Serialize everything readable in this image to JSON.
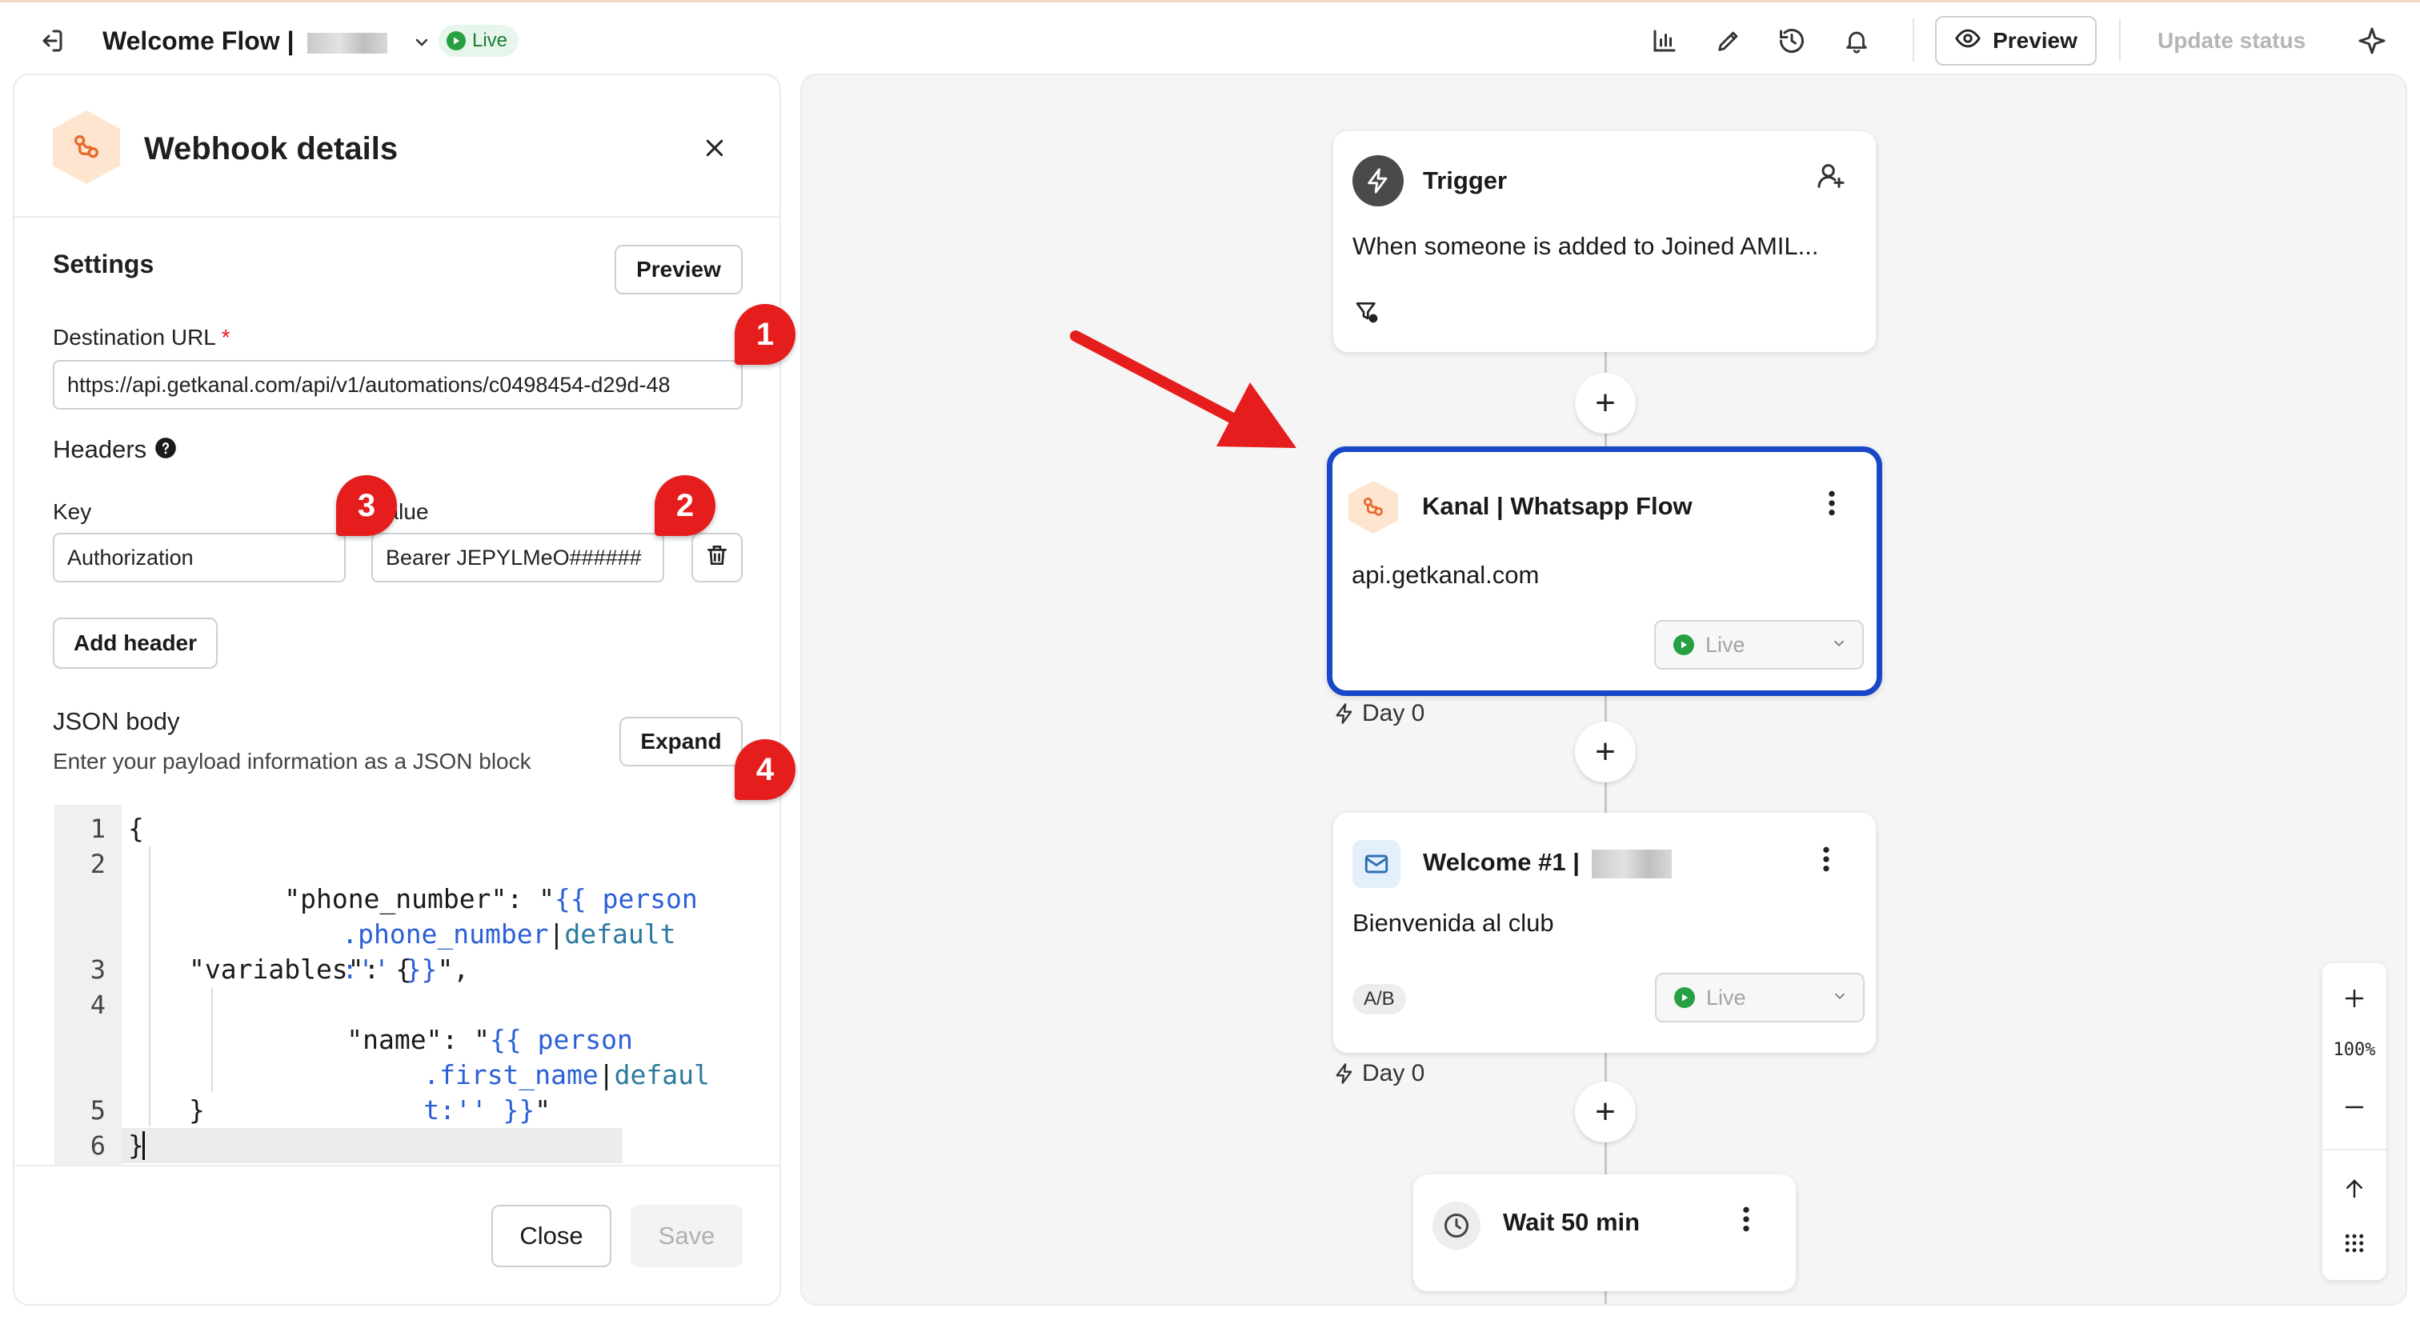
{
  "header": {
    "flow_title": "Welcome Flow |",
    "status": "Live",
    "preview_label": "Preview",
    "update_status_label": "Update status"
  },
  "panel": {
    "title": "Webhook details",
    "settings_title": "Settings",
    "preview_label": "Preview",
    "destination_url_label": "Destination URL",
    "required_mark": "*",
    "destination_url_value": "https://api.getkanal.com/api/v1/automations/c0498454-d29d-48",
    "headers_label": "Headers",
    "key_label": "Key",
    "value_label": "Value",
    "key_value": "Authorization",
    "value_value": "Bearer JEPYLMeO######",
    "add_header_label": "Add header",
    "json_body_label": "JSON body",
    "json_body_hint": "Enter your payload information as a JSON block",
    "expand_label": "Expand",
    "close_label": "Close",
    "save_label": "Save"
  },
  "code": {
    "line_numbers": [
      "1",
      "2",
      "3",
      "4",
      "5",
      "6"
    ],
    "l1": "{",
    "l2a": "\"phone_number\": \"",
    "l2b": "{{ person",
    "l2c": ".phone_number",
    "l2d": "|",
    "l2e": "default",
    "l2f": ":'' }}",
    "l2g": "\",",
    "l3": "\"variables\": {",
    "l4a": "\"name\": \"",
    "l4b": "{{ person",
    "l4c": ".first_name",
    "l4d": "|",
    "l4e": "defaul",
    "l4f": "t:'' }}",
    "l4g": "\"",
    "l5": "}",
    "l6": "}"
  },
  "annotations": [
    "1",
    "2",
    "3",
    "4"
  ],
  "canvas": {
    "trigger": {
      "title": "Trigger",
      "text": "When someone is added to Joined AMIL..."
    },
    "webhook_node": {
      "title": "Kanal | Whatsapp Flow",
      "text": "api.getkanal.com",
      "status": "Live",
      "day": "Day 0"
    },
    "email_node": {
      "title": "Welcome #1 |",
      "text": "Bienvenida al club",
      "ab_badge": "A/B",
      "status": "Live",
      "day": "Day 0"
    },
    "wait_node": {
      "title": "Wait 50 min"
    },
    "zoom_level": "100%"
  },
  "colors": {
    "accent_blue": "#1848c8",
    "annotation_red": "#e51d1d",
    "live_green": "#27a043",
    "hex_orange": "#fde5cf"
  }
}
